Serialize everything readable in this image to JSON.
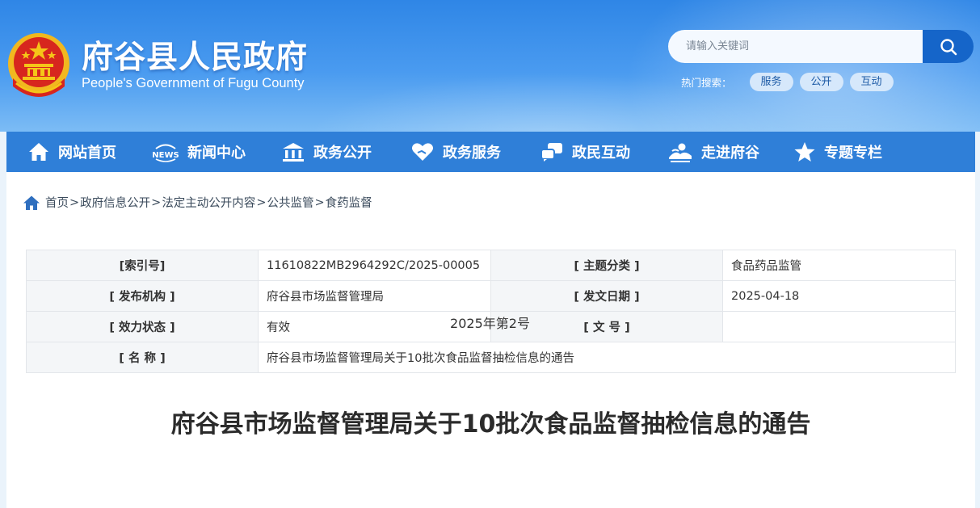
{
  "header": {
    "title": "府谷县人民政府",
    "subtitle": "People's Government of Fugu County",
    "emblem_icon": "national-emblem-icon"
  },
  "search": {
    "placeholder": "请输入关键词",
    "button_icon": "search-icon"
  },
  "hot_search": {
    "label": "热门搜索：",
    "tags": [
      "服务",
      "公开",
      "互动"
    ]
  },
  "nav": {
    "items": [
      {
        "label": "网站首页",
        "icon": "home-icon"
      },
      {
        "label": "新闻中心",
        "icon": "news-icon"
      },
      {
        "label": "政务公开",
        "icon": "government-building-icon"
      },
      {
        "label": "政务服务",
        "icon": "heart-hand-icon"
      },
      {
        "label": "政民互动",
        "icon": "chat-icon"
      },
      {
        "label": "走进府谷",
        "icon": "landscape-icon"
      },
      {
        "label": "专题专栏",
        "icon": "star-icon"
      }
    ]
  },
  "breadcrumb": {
    "icon": "home-icon",
    "items": [
      "首页",
      "政府信息公开",
      "法定主动公开内容",
      "公共监管",
      "食药监督"
    ],
    "separator": ">"
  },
  "meta": {
    "index_no_label": "[索引号]",
    "index_no": "11610822MB2964292C/2025-00005",
    "category_label": "[ 主题分类 ]",
    "category": "食品药品监管",
    "publisher_label": "[ 发布机构 ]",
    "publisher": "府谷县市场监督管理局",
    "date_label": "[ 发文日期 ]",
    "date": "2025-04-18",
    "status_label": "[ 效力状态 ]",
    "status": "有效",
    "docno_label": "[ 文 号 ]",
    "docno": "",
    "name_label": "[ 名 称 ]",
    "name": "府谷县市场监督管理局关于10批次食品监督抽检信息的通告"
  },
  "article": {
    "title": "府谷县市场监督管理局关于10批次食品监督抽检信息的通告",
    "doc_number": "2025年第2号"
  },
  "colors": {
    "header_blue": "#2f86e6",
    "nav_blue": "#2f7fd8",
    "search_button": "#1565c9",
    "emblem_red": "#d7261e",
    "emblem_gold": "#f5c518"
  }
}
